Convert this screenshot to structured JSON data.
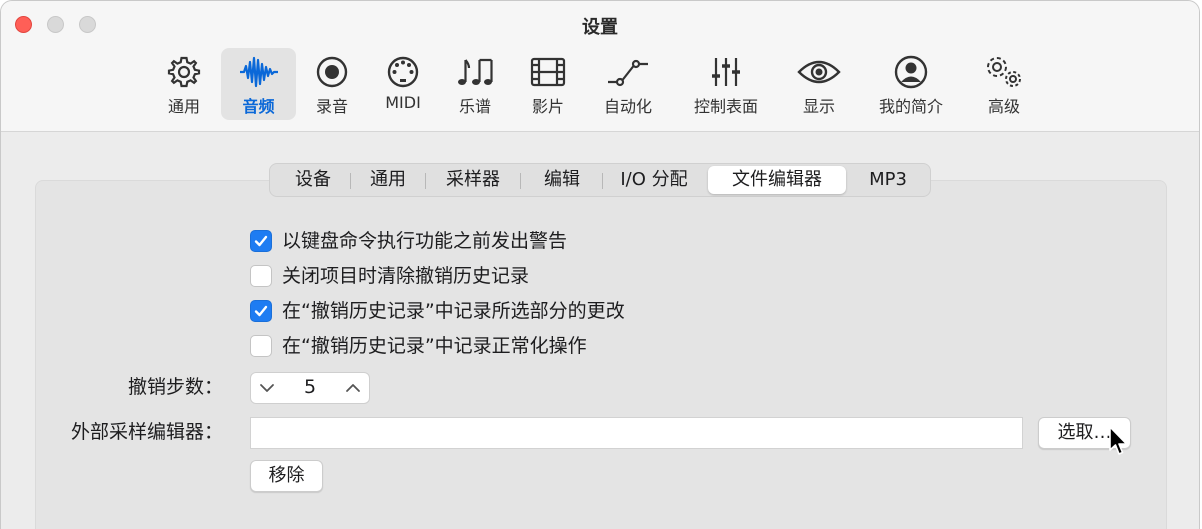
{
  "window": {
    "title": "设置"
  },
  "toolbar": {
    "items": [
      {
        "label": "通用",
        "icon": "gear-icon"
      },
      {
        "label": "音频",
        "icon": "waveform-icon",
        "active": true
      },
      {
        "label": "录音",
        "icon": "record-icon"
      },
      {
        "label": "MIDI",
        "icon": "midi-port-icon"
      },
      {
        "label": "乐谱",
        "icon": "music-notes-icon"
      },
      {
        "label": "影片",
        "icon": "film-icon"
      },
      {
        "label": "自动化",
        "icon": "automation-curve-icon"
      },
      {
        "label": "控制表面",
        "icon": "sliders-icon"
      },
      {
        "label": "显示",
        "icon": "eye-icon"
      },
      {
        "label": "我的简介",
        "icon": "person-circle-icon"
      },
      {
        "label": "高级",
        "icon": "gears-icon"
      }
    ]
  },
  "tabs": {
    "items": [
      "设备",
      "通用",
      "采样器",
      "编辑",
      "I/O 分配",
      "文件编辑器",
      "MP3"
    ],
    "selected": "文件编辑器"
  },
  "options": {
    "warn_before_key_command": {
      "label": "以键盘命令执行功能之前发出警告",
      "checked": true
    },
    "clear_undo_on_close": {
      "label": "关闭项目时清除撤销历史记录",
      "checked": false
    },
    "record_selection_changes": {
      "label": "在“撤销历史记录”中记录所选部分的更改",
      "checked": true
    },
    "record_normalize": {
      "label": "在“撤销历史记录”中记录正常化操作",
      "checked": false
    }
  },
  "undo_steps": {
    "label": "撤销步数：",
    "value": "5"
  },
  "external_editor": {
    "label": "外部采样编辑器：",
    "value": "",
    "choose_label": "选取…",
    "remove_label": "移除"
  },
  "colors": {
    "accent": "#1e7cf2",
    "active_tab_text": "#0a68d8",
    "close_button": "#ff5f57"
  }
}
